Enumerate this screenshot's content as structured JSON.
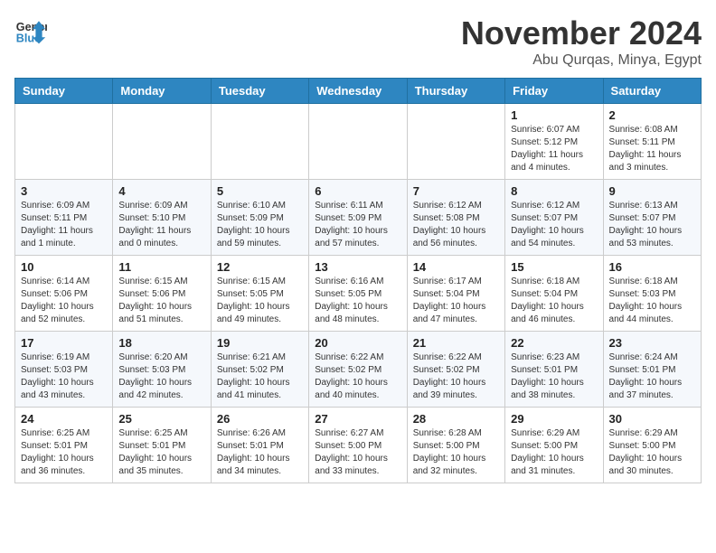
{
  "header": {
    "logo_line1": "General",
    "logo_line2": "Blue",
    "month": "November 2024",
    "location": "Abu Qurqas, Minya, Egypt"
  },
  "weekdays": [
    "Sunday",
    "Monday",
    "Tuesday",
    "Wednesday",
    "Thursday",
    "Friday",
    "Saturday"
  ],
  "weeks": [
    [
      {
        "day": "",
        "info": ""
      },
      {
        "day": "",
        "info": ""
      },
      {
        "day": "",
        "info": ""
      },
      {
        "day": "",
        "info": ""
      },
      {
        "day": "",
        "info": ""
      },
      {
        "day": "1",
        "info": "Sunrise: 6:07 AM\nSunset: 5:12 PM\nDaylight: 11 hours\nand 4 minutes."
      },
      {
        "day": "2",
        "info": "Sunrise: 6:08 AM\nSunset: 5:11 PM\nDaylight: 11 hours\nand 3 minutes."
      }
    ],
    [
      {
        "day": "3",
        "info": "Sunrise: 6:09 AM\nSunset: 5:11 PM\nDaylight: 11 hours\nand 1 minute."
      },
      {
        "day": "4",
        "info": "Sunrise: 6:09 AM\nSunset: 5:10 PM\nDaylight: 11 hours\nand 0 minutes."
      },
      {
        "day": "5",
        "info": "Sunrise: 6:10 AM\nSunset: 5:09 PM\nDaylight: 10 hours\nand 59 minutes."
      },
      {
        "day": "6",
        "info": "Sunrise: 6:11 AM\nSunset: 5:09 PM\nDaylight: 10 hours\nand 57 minutes."
      },
      {
        "day": "7",
        "info": "Sunrise: 6:12 AM\nSunset: 5:08 PM\nDaylight: 10 hours\nand 56 minutes."
      },
      {
        "day": "8",
        "info": "Sunrise: 6:12 AM\nSunset: 5:07 PM\nDaylight: 10 hours\nand 54 minutes."
      },
      {
        "day": "9",
        "info": "Sunrise: 6:13 AM\nSunset: 5:07 PM\nDaylight: 10 hours\nand 53 minutes."
      }
    ],
    [
      {
        "day": "10",
        "info": "Sunrise: 6:14 AM\nSunset: 5:06 PM\nDaylight: 10 hours\nand 52 minutes."
      },
      {
        "day": "11",
        "info": "Sunrise: 6:15 AM\nSunset: 5:06 PM\nDaylight: 10 hours\nand 51 minutes."
      },
      {
        "day": "12",
        "info": "Sunrise: 6:15 AM\nSunset: 5:05 PM\nDaylight: 10 hours\nand 49 minutes."
      },
      {
        "day": "13",
        "info": "Sunrise: 6:16 AM\nSunset: 5:05 PM\nDaylight: 10 hours\nand 48 minutes."
      },
      {
        "day": "14",
        "info": "Sunrise: 6:17 AM\nSunset: 5:04 PM\nDaylight: 10 hours\nand 47 minutes."
      },
      {
        "day": "15",
        "info": "Sunrise: 6:18 AM\nSunset: 5:04 PM\nDaylight: 10 hours\nand 46 minutes."
      },
      {
        "day": "16",
        "info": "Sunrise: 6:18 AM\nSunset: 5:03 PM\nDaylight: 10 hours\nand 44 minutes."
      }
    ],
    [
      {
        "day": "17",
        "info": "Sunrise: 6:19 AM\nSunset: 5:03 PM\nDaylight: 10 hours\nand 43 minutes."
      },
      {
        "day": "18",
        "info": "Sunrise: 6:20 AM\nSunset: 5:03 PM\nDaylight: 10 hours\nand 42 minutes."
      },
      {
        "day": "19",
        "info": "Sunrise: 6:21 AM\nSunset: 5:02 PM\nDaylight: 10 hours\nand 41 minutes."
      },
      {
        "day": "20",
        "info": "Sunrise: 6:22 AM\nSunset: 5:02 PM\nDaylight: 10 hours\nand 40 minutes."
      },
      {
        "day": "21",
        "info": "Sunrise: 6:22 AM\nSunset: 5:02 PM\nDaylight: 10 hours\nand 39 minutes."
      },
      {
        "day": "22",
        "info": "Sunrise: 6:23 AM\nSunset: 5:01 PM\nDaylight: 10 hours\nand 38 minutes."
      },
      {
        "day": "23",
        "info": "Sunrise: 6:24 AM\nSunset: 5:01 PM\nDaylight: 10 hours\nand 37 minutes."
      }
    ],
    [
      {
        "day": "24",
        "info": "Sunrise: 6:25 AM\nSunset: 5:01 PM\nDaylight: 10 hours\nand 36 minutes."
      },
      {
        "day": "25",
        "info": "Sunrise: 6:25 AM\nSunset: 5:01 PM\nDaylight: 10 hours\nand 35 minutes."
      },
      {
        "day": "26",
        "info": "Sunrise: 6:26 AM\nSunset: 5:01 PM\nDaylight: 10 hours\nand 34 minutes."
      },
      {
        "day": "27",
        "info": "Sunrise: 6:27 AM\nSunset: 5:00 PM\nDaylight: 10 hours\nand 33 minutes."
      },
      {
        "day": "28",
        "info": "Sunrise: 6:28 AM\nSunset: 5:00 PM\nDaylight: 10 hours\nand 32 minutes."
      },
      {
        "day": "29",
        "info": "Sunrise: 6:29 AM\nSunset: 5:00 PM\nDaylight: 10 hours\nand 31 minutes."
      },
      {
        "day": "30",
        "info": "Sunrise: 6:29 AM\nSunset: 5:00 PM\nDaylight: 10 hours\nand 30 minutes."
      }
    ]
  ]
}
